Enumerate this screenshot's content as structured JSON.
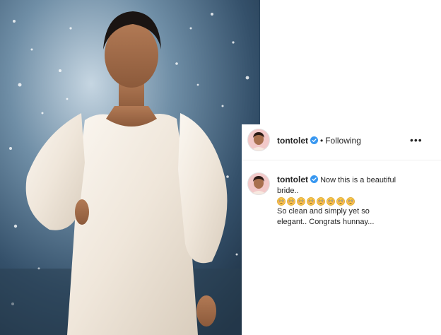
{
  "post": {
    "image_alt": "Woman in a white dress standing in front of a sparkling backdrop"
  },
  "header": {
    "username": "tontolet",
    "separator": "•",
    "follow_status": "Following",
    "more_label": "•••"
  },
  "caption": {
    "username": "tontolet",
    "line1": "Now this is a beautiful bride..",
    "emojis": [
      "😳",
      "😳",
      "😳",
      "😳",
      "😳",
      "😳",
      "😳",
      "😳"
    ],
    "line2": "So clean and simply yet so elegant.. Congrats hunnay..."
  },
  "colors": {
    "text": "#262626",
    "verified": "#3897f0",
    "border": "#efefef"
  },
  "icons": {
    "verified": "verified-badge-icon",
    "more": "more-options-icon",
    "avatar": "avatar"
  }
}
